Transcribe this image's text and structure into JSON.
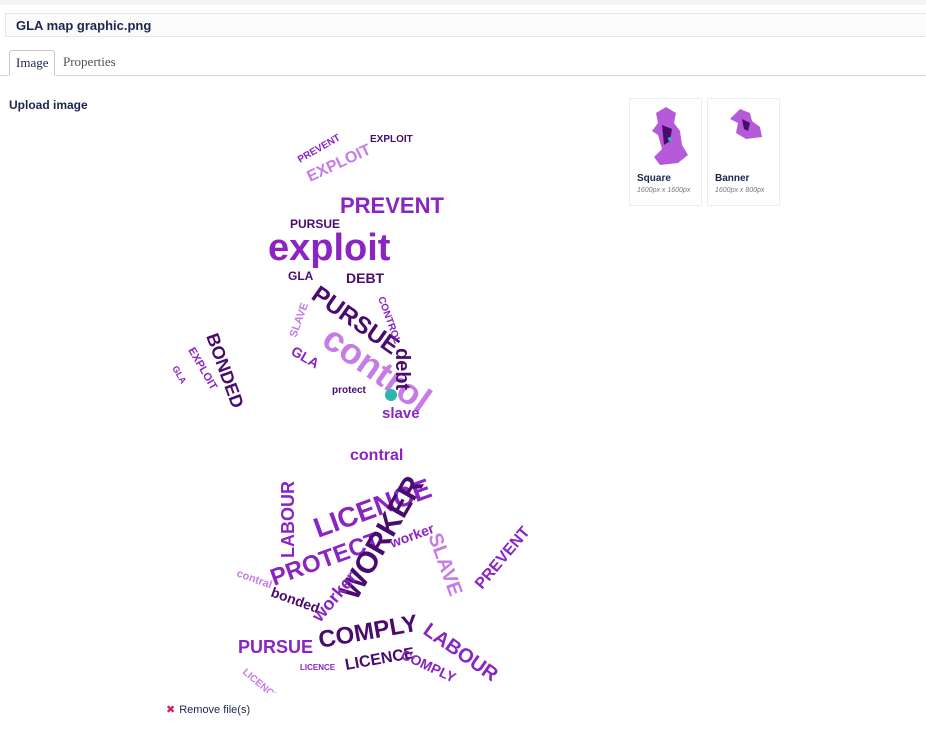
{
  "file": {
    "name": "GLA map graphic.png"
  },
  "tabs": [
    {
      "label": "Image",
      "active": true
    },
    {
      "label": "Properties",
      "active": false
    }
  ],
  "upload": {
    "title": "Upload image"
  },
  "crops": [
    {
      "name": "Square",
      "size": "1600px x 1600px"
    },
    {
      "name": "Banner",
      "size": "1600px x 800px"
    }
  ],
  "remove": {
    "icon": "close-icon",
    "label": "Remove file(s)"
  },
  "colors": {
    "dark_purple": "#4a0b6e",
    "purple": "#8a24c2",
    "light_purple": "#c67be6",
    "teal": "#2bb7b0"
  },
  "wordcloud": {
    "words": [
      "EXPLOIT",
      "PREVENT",
      "exploit",
      "PURSUE",
      "control",
      "DEBT",
      "debt",
      "CONTROL",
      "BONDED",
      "GLA",
      "SLAVE",
      "slave",
      "LICENCE",
      "PROTECT",
      "WORKER",
      "worker",
      "LABOUR",
      "COMPLY",
      "bonded",
      "contral",
      "EXPLOIT",
      "PURSUE",
      "LICENCE",
      "COMPLY",
      "LABOUR",
      "PREVENT",
      "SLAVE",
      "protect"
    ]
  }
}
